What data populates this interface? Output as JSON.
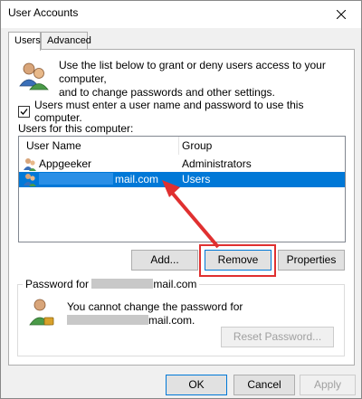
{
  "window": {
    "title": "User Accounts"
  },
  "tabs": [
    {
      "label": "Users"
    },
    {
      "label": "Advanced"
    }
  ],
  "info": {
    "text_line1": "Use the list below to grant or deny users access to your computer,",
    "text_line2": "and to change passwords and other settings."
  },
  "require_login": {
    "label": "Users must enter a user name and password to use this computer.",
    "checked": true
  },
  "users_list": {
    "label": "Users for this computer:",
    "columns": [
      "User Name",
      "Group"
    ],
    "rows": [
      {
        "name": "Appgeeker",
        "group": "Administrators",
        "selected": false
      },
      {
        "name": "mail.com",
        "group": "Users",
        "selected": true
      }
    ]
  },
  "list_buttons": {
    "add": "Add...",
    "remove": "Remove",
    "properties": "Properties"
  },
  "password_group": {
    "label_prefix": "Password for",
    "label_suffix": "mail.com",
    "message_line1": "You cannot change the password for",
    "message_line2_suffix": "mail.com.",
    "reset_button": "Reset Password..."
  },
  "dialog_buttons": {
    "ok": "OK",
    "cancel": "Cancel",
    "apply": "Apply"
  },
  "colors": {
    "selection": "#0078d7",
    "annotation": "#e03030"
  }
}
